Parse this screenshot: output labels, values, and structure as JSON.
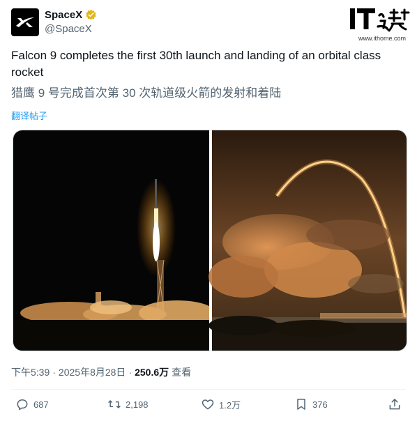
{
  "author": {
    "display_name": "SpaceX",
    "handle": "@SpaceX"
  },
  "watermark": {
    "logo_text": "IT之家",
    "url": "www.ithome.com"
  },
  "tweet": {
    "text": "Falcon 9 completes the first 30th launch and landing of an orbital class rocket",
    "translated_text": "猎鹰 9 号完成首次第 30 次轨道级火箭的发射和着陆",
    "translate_label": "翻译帖子"
  },
  "meta": {
    "time": "下午5:39",
    "separator": "·",
    "date": "2025年8月28日",
    "views_count": "250.6万",
    "views_label": "查看"
  },
  "actions": {
    "replies": "687",
    "reposts": "2,198",
    "likes": "1.2万",
    "bookmarks": "376"
  },
  "colors": {
    "accent": "#1d9bf0",
    "verified": "#e2b719",
    "secondary_text": "#536471"
  },
  "icons": [
    "x-logo-icon",
    "verified-badge-icon",
    "reply-icon",
    "repost-icon",
    "like-icon",
    "bookmark-icon",
    "share-icon"
  ]
}
